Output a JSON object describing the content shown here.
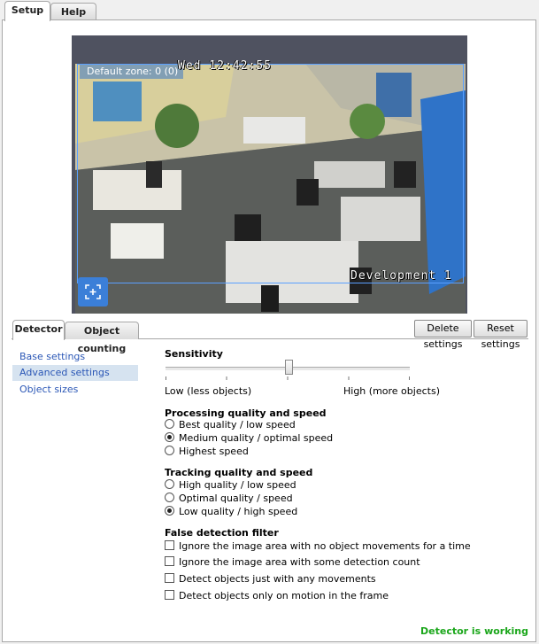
{
  "top_tabs": [
    {
      "label": "Setup"
    },
    {
      "label": "Help"
    }
  ],
  "video": {
    "zone_label": "Default zone: 0 (0)",
    "osd_time": "Wed 12:42:55",
    "osd_camera": "Development 1"
  },
  "sub_tabs": [
    {
      "label": "Detector"
    },
    {
      "label": "Object counting"
    }
  ],
  "buttons": {
    "delete": "Delete settings",
    "reset": "Reset settings"
  },
  "nav": [
    {
      "label": "Base settings"
    },
    {
      "label": "Advanced settings"
    },
    {
      "label": "Object sizes"
    }
  ],
  "sensitivity": {
    "title": "Sensitivity",
    "low": "Low (less objects)",
    "high": "High (more objects)",
    "value": 0.5
  },
  "processing": {
    "title": "Processing quality and speed",
    "options": [
      "Best quality / low speed",
      "Medium quality / optimal speed",
      "Highest speed"
    ],
    "selected": 1
  },
  "tracking": {
    "title": "Tracking quality and speed",
    "options": [
      "High quality / low speed",
      "Optimal quality / speed",
      "Low quality / high speed"
    ],
    "selected": 2
  },
  "filter": {
    "title": "False detection filter",
    "options": [
      "Ignore the image area with no object movements for a time",
      "Ignore the image area with some detection count",
      "Detect objects just with any movements",
      "Detect objects only on motion in the frame"
    ]
  },
  "status": "Detector is working",
  "colors": {
    "status": "#1aa61a",
    "link": "#2b57b6",
    "zone": "#5aa0ff"
  }
}
